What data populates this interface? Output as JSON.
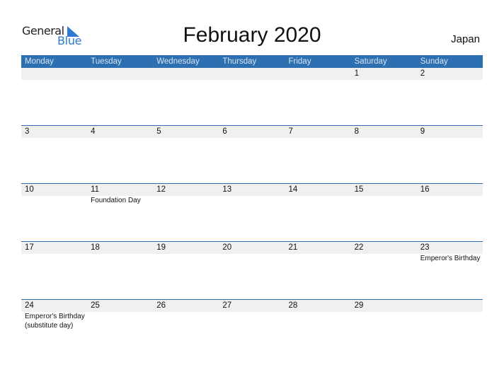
{
  "logo": {
    "word1": "General",
    "word2": "Blue",
    "accent_color": "#2e7ad1"
  },
  "title": "February 2020",
  "country": "Japan",
  "colors": {
    "header_bg": "#2e6fb1",
    "band_bg": "#f0f0f0"
  },
  "weekdays": [
    "Monday",
    "Tuesday",
    "Wednesday",
    "Thursday",
    "Friday",
    "Saturday",
    "Sunday"
  ],
  "weeks": [
    {
      "days": [
        {
          "num": "",
          "event": ""
        },
        {
          "num": "",
          "event": ""
        },
        {
          "num": "",
          "event": ""
        },
        {
          "num": "",
          "event": ""
        },
        {
          "num": "",
          "event": ""
        },
        {
          "num": "1",
          "event": ""
        },
        {
          "num": "2",
          "event": ""
        }
      ]
    },
    {
      "days": [
        {
          "num": "3",
          "event": ""
        },
        {
          "num": "4",
          "event": ""
        },
        {
          "num": "5",
          "event": ""
        },
        {
          "num": "6",
          "event": ""
        },
        {
          "num": "7",
          "event": ""
        },
        {
          "num": "8",
          "event": ""
        },
        {
          "num": "9",
          "event": ""
        }
      ]
    },
    {
      "days": [
        {
          "num": "10",
          "event": ""
        },
        {
          "num": "11",
          "event": "Foundation Day"
        },
        {
          "num": "12",
          "event": ""
        },
        {
          "num": "13",
          "event": ""
        },
        {
          "num": "14",
          "event": ""
        },
        {
          "num": "15",
          "event": ""
        },
        {
          "num": "16",
          "event": ""
        }
      ]
    },
    {
      "days": [
        {
          "num": "17",
          "event": ""
        },
        {
          "num": "18",
          "event": ""
        },
        {
          "num": "19",
          "event": ""
        },
        {
          "num": "20",
          "event": ""
        },
        {
          "num": "21",
          "event": ""
        },
        {
          "num": "22",
          "event": ""
        },
        {
          "num": "23",
          "event": "Emperor's Birthday"
        }
      ]
    },
    {
      "days": [
        {
          "num": "24",
          "event": "Emperor's Birthday",
          "event2": "(substitute day)"
        },
        {
          "num": "25",
          "event": ""
        },
        {
          "num": "26",
          "event": ""
        },
        {
          "num": "27",
          "event": ""
        },
        {
          "num": "28",
          "event": ""
        },
        {
          "num": "29",
          "event": ""
        },
        {
          "num": "",
          "event": ""
        }
      ]
    }
  ]
}
